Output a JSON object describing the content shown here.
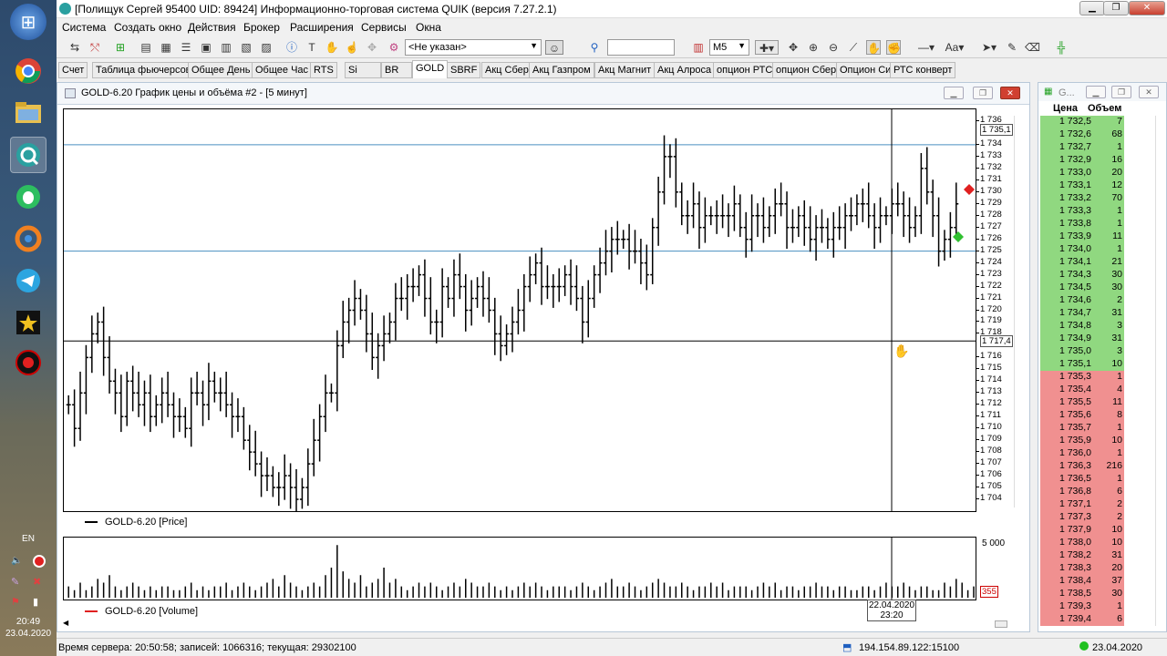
{
  "taskbar": {
    "lang": "EN",
    "time": "20:49",
    "date": "23.04.2020"
  },
  "window": {
    "title": "[Полищук Сергей 95400 UID: 89424] Информационно-торговая система QUIK (версия 7.27.2.1)"
  },
  "menu": [
    "Система",
    "Создать окно",
    "Действия",
    "Брокер",
    "Расширения",
    "Сервисы",
    "Окна"
  ],
  "toolbar": {
    "account_combo": "<Не указан>",
    "interval_combo": "M5",
    "font_label": "Aa"
  },
  "tabs": [
    "Счет",
    "Таблица фьючерсов",
    "Общее День",
    "Общее Час",
    "RTS",
    "Si",
    "BR",
    "GOLD",
    "SBRF",
    "Акц Сбер",
    "Акц Газпром",
    "Акц Магнит",
    "Акц Алроса",
    "опцион РТС",
    "опцион Сбер",
    "Опцион Си",
    "РТС конверт"
  ],
  "active_tab": "GOLD",
  "chart_window": {
    "title": "GOLD-6.20 График цены и объёма #2 - [5 минут]",
    "price_legend": "GOLD-6.20 [Price]",
    "volume_legend": "GOLD-6.20 [Volume]",
    "last_price_label": "1 735,1",
    "crosshair_price_label": "1 717,4",
    "crosshair_date": "22.04.2020",
    "crosshair_time": "23:20",
    "volume_max_label": "5 000",
    "volume_last_label": "355",
    "yticks": [
      "1 736",
      "1 734",
      "1 733",
      "1 732",
      "1 731",
      "1 730",
      "1 729",
      "1 728",
      "1 727",
      "1 726",
      "1 725",
      "1 724",
      "1 723",
      "1 722",
      "1 721",
      "1 720",
      "1 719",
      "1 718",
      "1 716",
      "1 715",
      "1 714",
      "1 713",
      "1 712",
      "1 711",
      "1 710",
      "1 709",
      "1 708",
      "1 707",
      "1 706",
      "1 705",
      "1 704"
    ]
  },
  "chart_data": {
    "type": "ohlc",
    "symbol": "GOLD-6.20",
    "interval": "5 минут",
    "ylim": [
      1703,
      1737
    ],
    "hlines": [
      1734,
      1725,
      1717.4
    ],
    "closes": [
      1712,
      1710,
      1713,
      1716,
      1718,
      1719,
      1716,
      1714,
      1713,
      1711,
      1714,
      1713,
      1712,
      1713,
      1711,
      1712,
      1713,
      1712,
      1711,
      1711,
      1710,
      1713,
      1713,
      1712,
      1714,
      1713,
      1713,
      1712,
      1711,
      1711,
      1709,
      1708,
      1707,
      1706,
      1706,
      1705,
      1705,
      1706,
      1705,
      1704,
      1705,
      1707,
      1709,
      1711,
      1713,
      1713,
      1717,
      1719,
      1720,
      1721,
      1720,
      1718,
      1716,
      1717,
      1718,
      1719,
      1721,
      1721,
      1722,
      1722,
      1723,
      1721,
      1719,
      1719,
      1722,
      1721,
      1723,
      1722,
      1720,
      1721,
      1722,
      1721,
      1720,
      1718,
      1717,
      1718,
      1719,
      1720,
      1722,
      1723,
      1724,
      1722,
      1722,
      1722,
      1722,
      1723,
      1722,
      1721,
      1719,
      1721,
      1723,
      1724,
      1725,
      1726,
      1726,
      1726,
      1725,
      1725,
      1724,
      1723,
      1727,
      1730,
      1733,
      1733,
      1730,
      1728,
      1728,
      1729,
      1727,
      1728,
      1728,
      1728,
      1728,
      1728,
      1729,
      1727,
      1726,
      1728,
      1728,
      1727,
      1728,
      1729,
      1729,
      1727,
      1727,
      1728,
      1727,
      1726,
      1727,
      1727,
      1726,
      1727,
      1727,
      1728,
      1728,
      1729,
      1729,
      1728,
      1727,
      1728,
      1728,
      1729,
      1729,
      1728,
      1727,
      1728,
      1732,
      1730,
      1728,
      1725,
      1726,
      1727,
      1729
    ],
    "volumes": [
      3,
      2,
      4,
      2,
      3,
      5,
      4,
      6,
      3,
      2,
      3,
      4,
      3,
      2,
      3,
      2,
      3,
      3,
      2,
      2,
      3,
      4,
      2,
      3,
      2,
      3,
      3,
      4,
      2,
      3,
      4,
      3,
      2,
      3,
      4,
      5,
      3,
      6,
      4,
      3,
      2,
      3,
      4,
      3,
      6,
      8,
      14,
      7,
      5,
      4,
      6,
      3,
      4,
      5,
      8,
      4,
      5,
      3,
      2,
      3,
      4,
      3,
      4,
      3,
      2,
      3,
      4,
      3,
      5,
      4,
      3,
      3,
      4,
      3,
      2,
      3,
      2,
      3,
      4,
      3,
      4,
      3,
      2,
      3,
      3,
      3,
      2,
      3,
      4,
      3,
      2,
      3,
      4,
      5,
      3,
      3,
      4,
      3,
      2,
      3,
      4,
      5,
      4,
      3,
      3,
      4,
      3,
      2,
      3,
      3,
      4,
      3,
      4,
      2,
      3,
      3,
      3,
      2,
      3,
      4,
      3,
      4,
      2,
      3,
      3,
      2,
      3,
      3,
      4,
      3,
      3,
      2,
      3,
      3,
      2,
      2,
      3,
      3,
      2,
      3,
      4,
      3,
      3,
      4,
      3,
      2,
      3,
      3,
      2,
      2,
      4,
      3,
      5,
      4,
      2,
      3,
      2
    ]
  },
  "glass": {
    "title": "G...",
    "col_price": "Цена",
    "col_volume": "Объем",
    "bids": [
      [
        "1 732,5",
        "7"
      ],
      [
        "1 732,6",
        "68"
      ],
      [
        "1 732,7",
        "1"
      ],
      [
        "1 732,9",
        "16"
      ],
      [
        "1 733,0",
        "20"
      ],
      [
        "1 733,1",
        "12"
      ],
      [
        "1 733,2",
        "70"
      ],
      [
        "1 733,3",
        "1"
      ],
      [
        "1 733,8",
        "1"
      ],
      [
        "1 733,9",
        "11"
      ],
      [
        "1 734,0",
        "1"
      ],
      [
        "1 734,1",
        "21"
      ],
      [
        "1 734,3",
        "30"
      ],
      [
        "1 734,5",
        "30"
      ],
      [
        "1 734,6",
        "2"
      ],
      [
        "1 734,7",
        "31"
      ],
      [
        "1 734,8",
        "3"
      ],
      [
        "1 734,9",
        "31"
      ],
      [
        "1 735,0",
        "3"
      ],
      [
        "1 735,1",
        "10"
      ]
    ],
    "asks": [
      [
        "1 735,3",
        "1"
      ],
      [
        "1 735,4",
        "4"
      ],
      [
        "1 735,5",
        "11"
      ],
      [
        "1 735,6",
        "8"
      ],
      [
        "1 735,7",
        "1"
      ],
      [
        "1 735,9",
        "10"
      ],
      [
        "1 736,0",
        "1"
      ],
      [
        "1 736,3",
        "216"
      ],
      [
        "1 736,5",
        "1"
      ],
      [
        "1 736,8",
        "6"
      ],
      [
        "1 737,1",
        "2"
      ],
      [
        "1 737,3",
        "2"
      ],
      [
        "1 737,9",
        "10"
      ],
      [
        "1 738,0",
        "10"
      ],
      [
        "1 738,2",
        "31"
      ],
      [
        "1 738,3",
        "20"
      ],
      [
        "1 738,4",
        "37"
      ],
      [
        "1 738,5",
        "30"
      ],
      [
        "1 739,3",
        "1"
      ],
      [
        "1 739,4",
        "6"
      ]
    ],
    "bid_color": "#90d880",
    "ask_color": "#f09090"
  },
  "status": {
    "left": "Время сервера: 20:50:58; записей: 1066316; текущая: 29302100",
    "ip": "194.154.89.122:15100",
    "date": "23.04.2020"
  }
}
